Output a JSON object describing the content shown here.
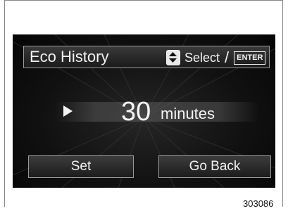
{
  "screen": {
    "title": "Eco History",
    "hint": {
      "icon": "up-down-arrows-icon",
      "select_label": "Select",
      "separator": "/",
      "enter_label": "ENTER"
    },
    "setting": {
      "indicator_icon": "right-arrow-icon",
      "value": "30",
      "unit": "minutes"
    },
    "buttons": {
      "set_label": "Set",
      "back_label": "Go Back"
    }
  },
  "figure_id": "303086",
  "colors": {
    "screen_background": "#111111",
    "text": "#f2f2f2",
    "border": "#9a9a9a"
  }
}
